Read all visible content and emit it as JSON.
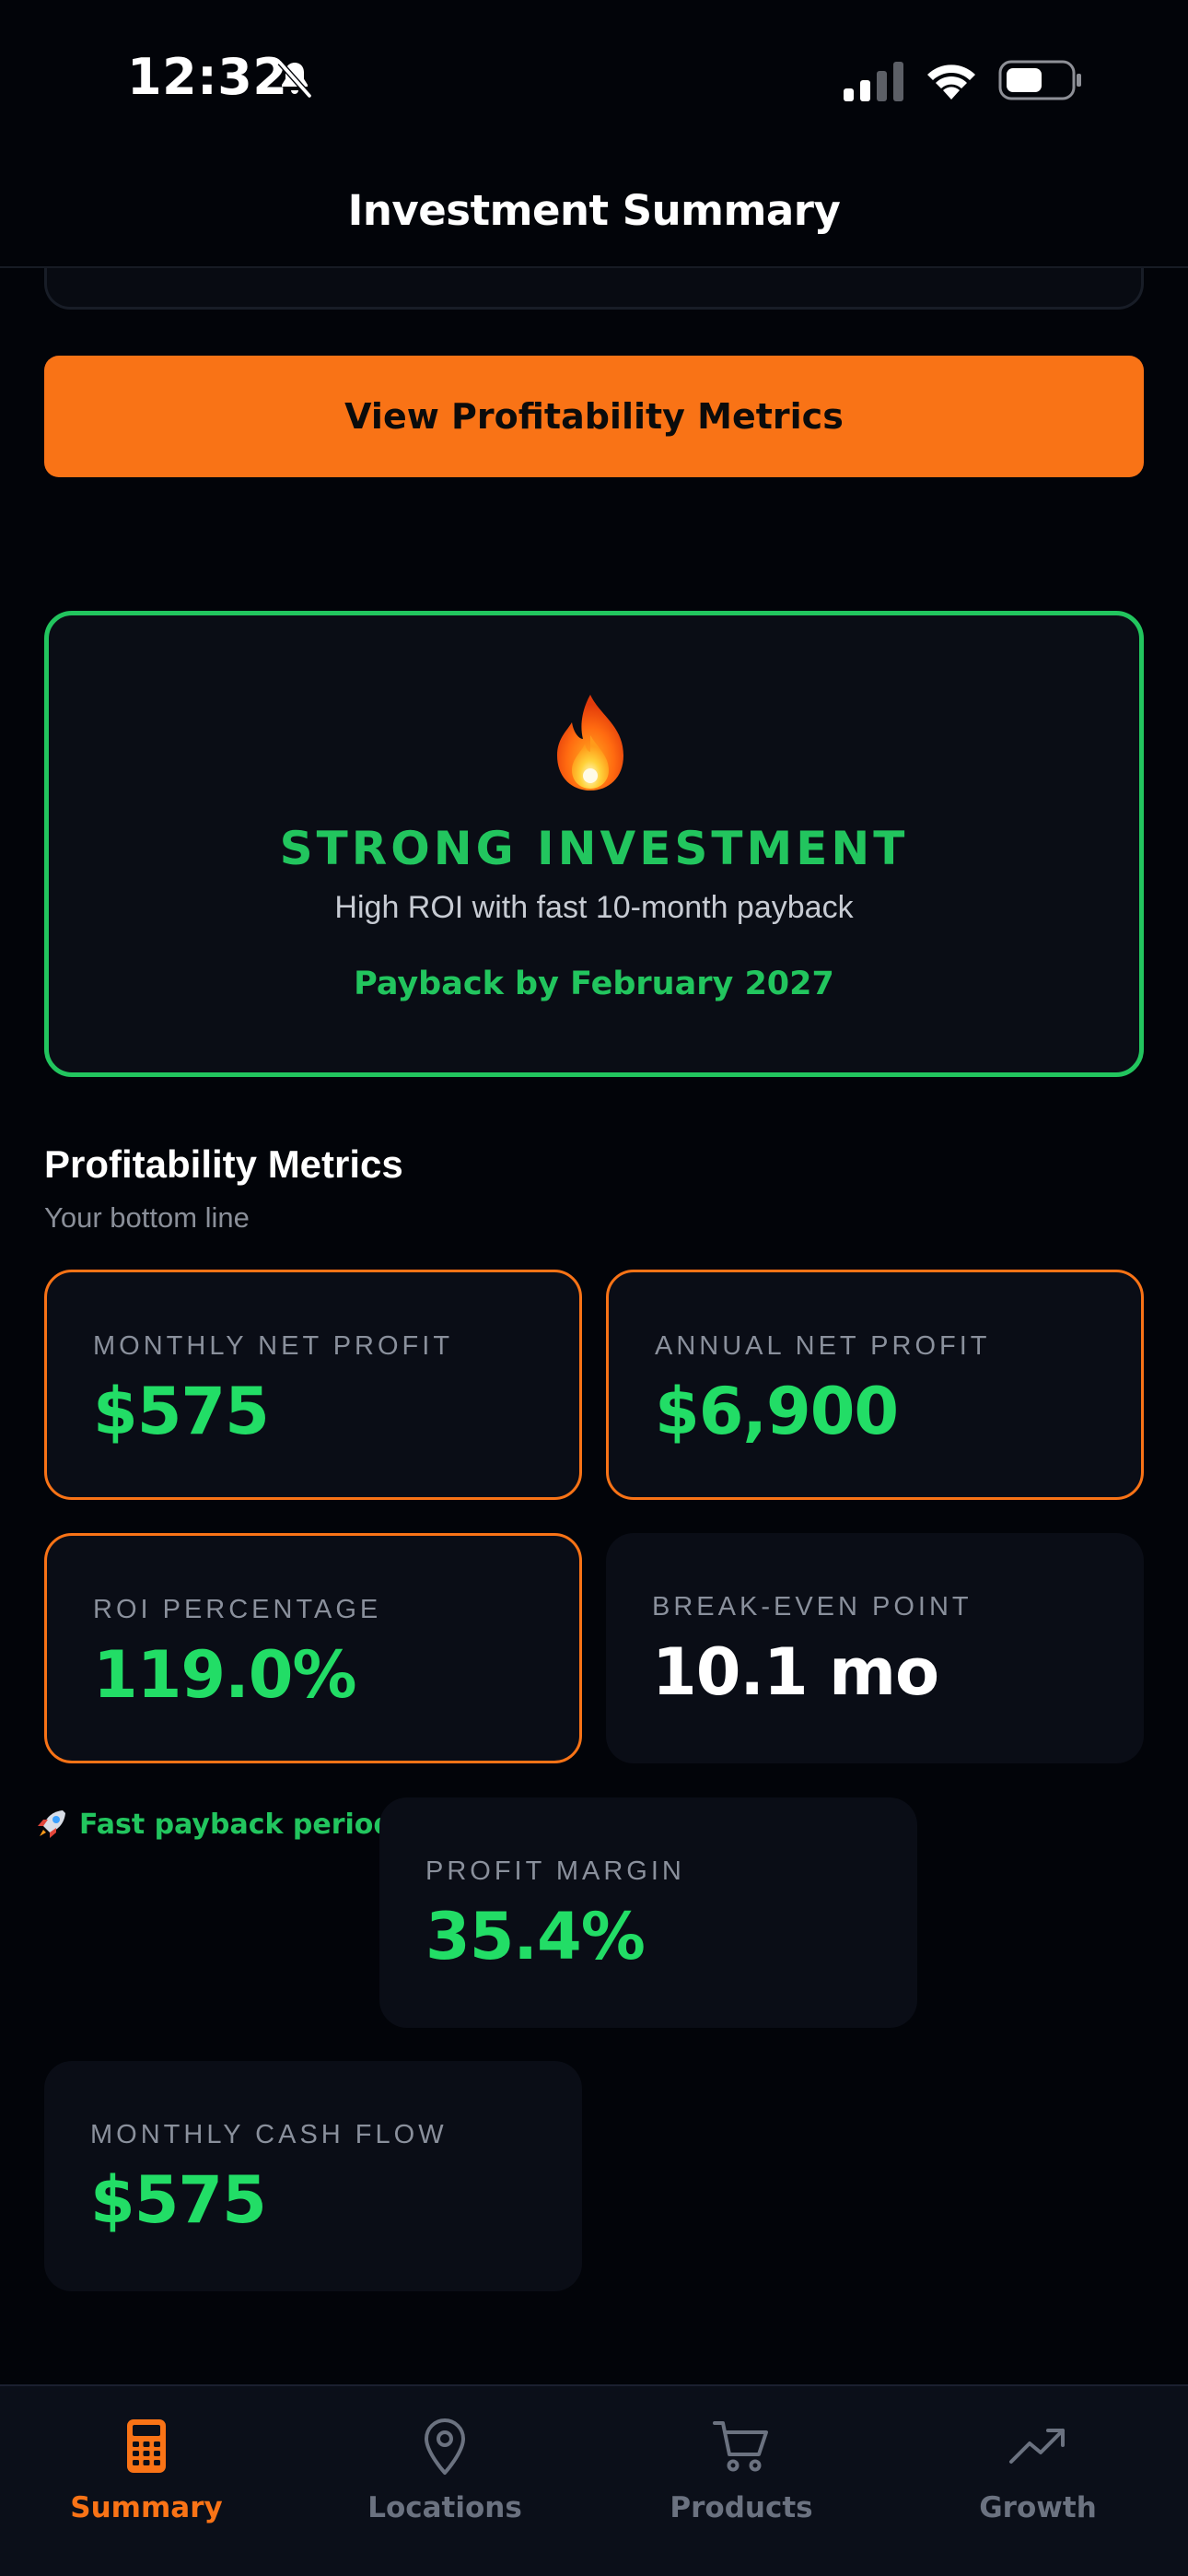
{
  "status_bar": {
    "time": "12:32",
    "icons": [
      "bell-slash-icon",
      "cellular-signal-icon",
      "wifi-icon",
      "battery-icon"
    ]
  },
  "header": {
    "title": "Investment Summary"
  },
  "primary_button": {
    "label": "View Profitability Metrics"
  },
  "verdict": {
    "icon": "fire-icon",
    "title": "STRONG INVESTMENT",
    "subtitle": "High ROI with fast 10-month payback",
    "payback": "Payback by February 2027"
  },
  "section": {
    "title": "Profitability Metrics",
    "subtitle": "Your bottom line"
  },
  "metrics": [
    {
      "label": "MONTHLY NET PROFIT",
      "value": "$575"
    },
    {
      "label": "ANNUAL NET PROFIT",
      "value": "$6,900"
    },
    {
      "label": "ROI PERCENTAGE",
      "value": "119.0%"
    },
    {
      "label": "BREAK-EVEN POINT",
      "value": "10.1 mo"
    },
    {
      "label": "PROFIT MARGIN",
      "value": "35.4%"
    },
    {
      "label": "MONTHLY CASH FLOW",
      "value": "$575"
    }
  ],
  "fast_note": {
    "icon": "rocket-icon",
    "text": "Fast payback period"
  },
  "tabbar": {
    "active": "Summary",
    "tabs": [
      {
        "label": "Summary",
        "icon": "calculator-icon"
      },
      {
        "label": "Locations",
        "icon": "map-pin-icon"
      },
      {
        "label": "Products",
        "icon": "cart-icon"
      },
      {
        "label": "Growth",
        "icon": "trending-up-icon"
      }
    ]
  },
  "colors": {
    "background": "#020409",
    "accent": "#f97316",
    "success": "#22c55e",
    "value_green": "#22dd66",
    "card": "#0a0d16"
  }
}
